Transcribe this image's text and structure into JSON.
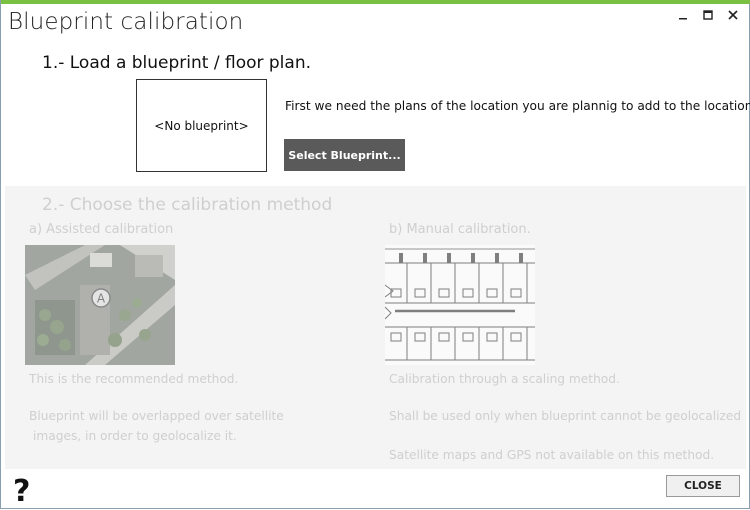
{
  "window": {
    "title": "Blueprint calibration",
    "accent_color": "#7ac143"
  },
  "step1": {
    "heading": "1.- Load a blueprint / floor plan.",
    "placeholder": "<No blueprint>",
    "instruction": "First we need the plans of the location you are plannig to add to the location",
    "select_button": "Select Blueprint..."
  },
  "step2": {
    "heading": "2.- Choose the calibration method",
    "assisted": {
      "label": "a) Assisted calibration",
      "desc1": "This is the recommended method.",
      "desc2_line1": "Blueprint will be overlapped over satellite",
      "desc2_line2": "images, in order to geolocalize it.",
      "marker": "A"
    },
    "manual": {
      "label": "b) Manual calibration.",
      "desc1": "Calibration through a scaling method.",
      "desc2": "Shall be used only when blueprint cannot be geolocalized",
      "desc3": "Satellite maps and GPS not available on this method."
    }
  },
  "footer": {
    "help": "?",
    "close_button": "CLOSE"
  }
}
